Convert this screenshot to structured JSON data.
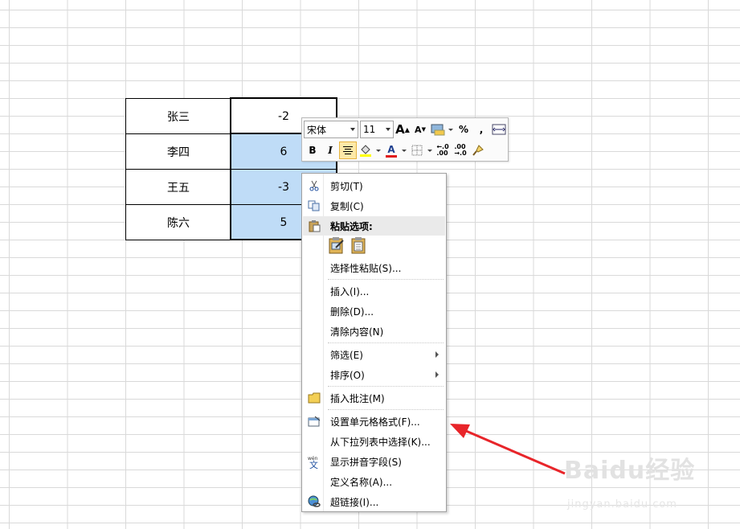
{
  "table": {
    "rows": [
      {
        "name": "张三",
        "value": "-2"
      },
      {
        "name": "李四",
        "value": "6"
      },
      {
        "name": "王五",
        "value": "-3"
      },
      {
        "name": "陈六",
        "value": "5"
      }
    ]
  },
  "mini_toolbar": {
    "font": "宋体",
    "size": "11",
    "percent": "%",
    "comma": ",",
    "bold": "B",
    "italic": "I",
    "font_color_label": "A"
  },
  "menu": {
    "cut": "剪切(T)",
    "copy": "复制(C)",
    "paste_options": "粘贴选项:",
    "paste_special": "选择性粘贴(S)...",
    "insert": "插入(I)...",
    "delete": "删除(D)...",
    "clear": "清除内容(N)",
    "filter": "筛选(E)",
    "sort": "排序(O)",
    "insert_comment": "插入批注(M)",
    "format_cells": "设置单元格格式(F)...",
    "pick_list": "从下拉列表中选择(K)...",
    "phonetic": "显示拼音字段(S)",
    "define_name": "定义名称(A)...",
    "hyperlink": "超链接(I)..."
  },
  "watermark": {
    "main": "Baidu经验",
    "sub": "jingyan.baidu.com"
  },
  "colors": {
    "selection": "#bfdcf7",
    "arrow": "#e8252a"
  }
}
